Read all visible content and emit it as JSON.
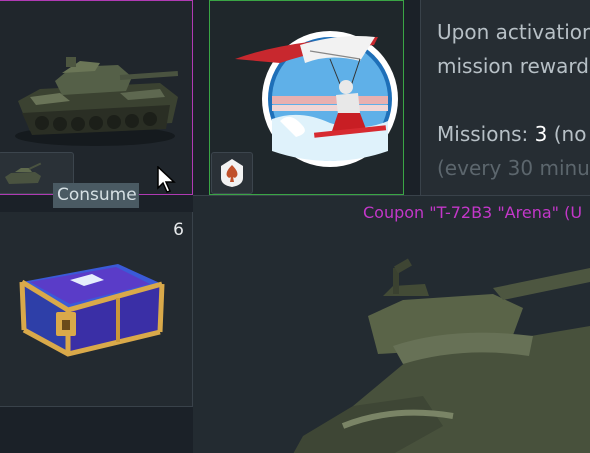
{
  "tooltip": {
    "label": "Consume"
  },
  "chest": {
    "count": "6"
  },
  "info": {
    "line1": "Upon activation",
    "line2": "mission reward",
    "missions_label": "Missions: ",
    "missions_value": "3",
    "missions_suffix": " (no",
    "line4": "(every 30 minu"
  },
  "preview": {
    "coupon_title": "Coupon \"T-72B3 \"Arena\" (U"
  },
  "colors": {
    "selected_border": "#b03ab4",
    "active_border": "#3aa545",
    "coupon_text": "#c337c9"
  },
  "icons": [
    "tank-icon",
    "kite-surfer-icon",
    "spade-icon",
    "treasure-chest-icon",
    "cursor-icon"
  ]
}
